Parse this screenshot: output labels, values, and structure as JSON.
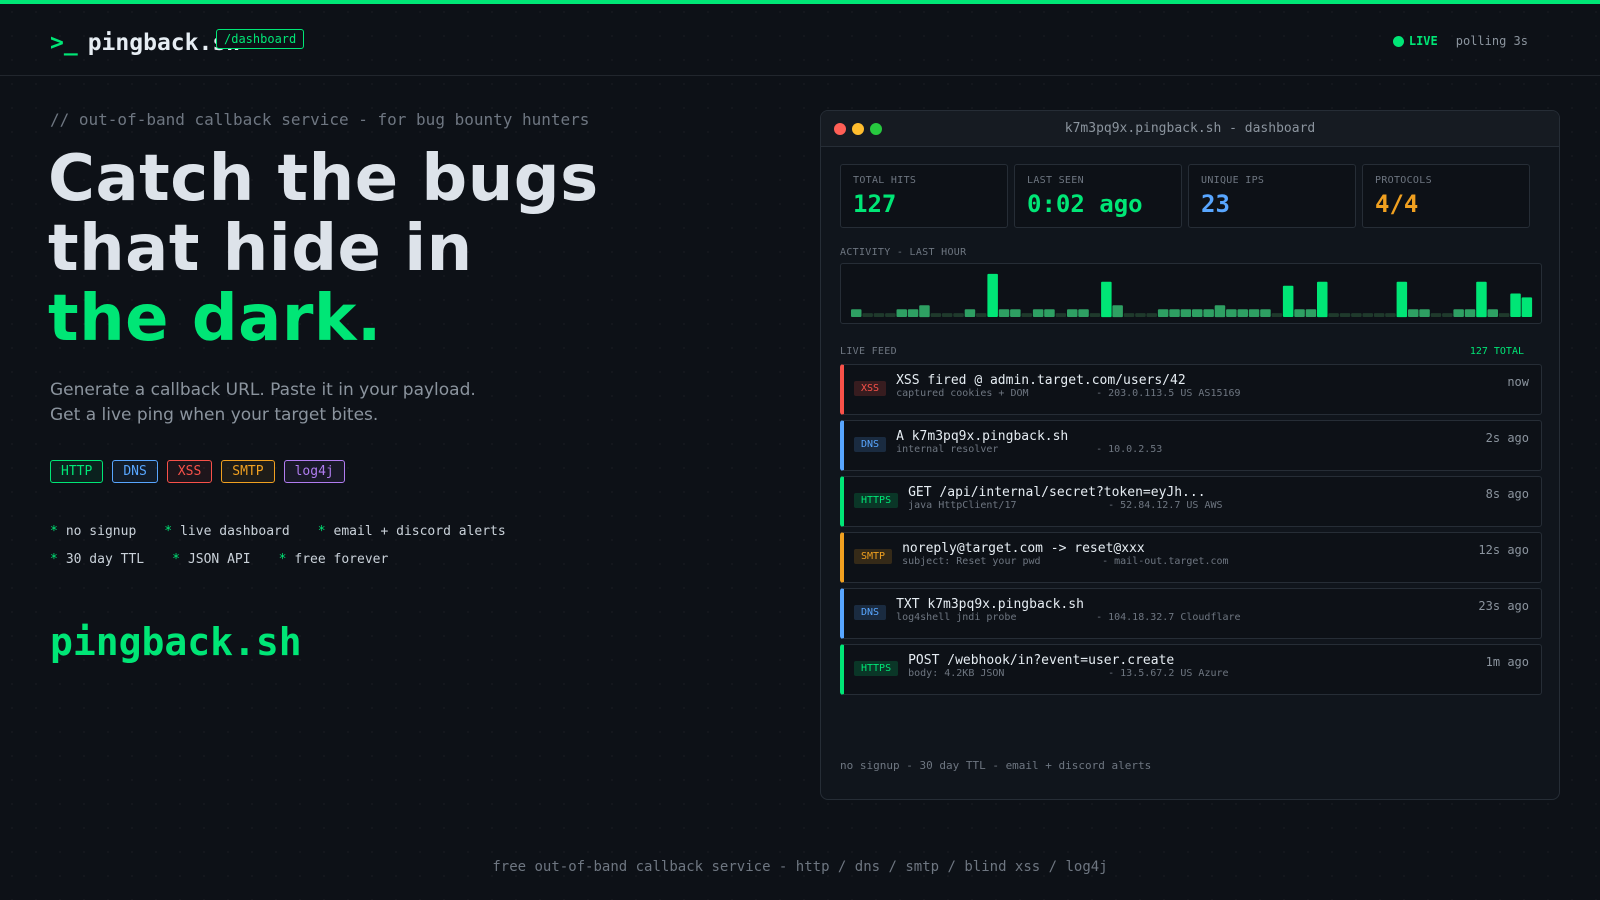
{
  "colors": {
    "accent": "#00e676",
    "dns": "#58a6ff",
    "xss": "#f85149",
    "smtp": "#f0a020",
    "log4j": "#b07cf0"
  },
  "header": {
    "prompt": ">_",
    "brand": "pingback.sh",
    "tag": "/dashboard",
    "live_label": "LIVE",
    "polling": "polling 3s"
  },
  "hero": {
    "tagline": "// out-of-band callback service - for bug bounty hunters",
    "line1": "Catch the bugs",
    "line2": "that hide in",
    "line3": "the dark.",
    "sub1": "Generate a callback URL. Paste it in your payload.",
    "sub2": "Get a live ping when your target bites."
  },
  "chips": [
    "HTTP",
    "DNS",
    "XSS",
    "SMTP",
    "log4j"
  ],
  "features": {
    "row1": [
      "no signup",
      "live dashboard",
      "email + discord alerts"
    ],
    "row2": [
      "30 day TTL",
      "JSON API",
      "free forever"
    ]
  },
  "big_brand": "pingback.sh",
  "footer": "free out-of-band callback service - http / dns / smtp / blind xss / log4j",
  "window": {
    "title": "k7m3pq9x.pingback.sh - dashboard",
    "stats": [
      {
        "label": "TOTAL HITS",
        "value": "127",
        "color": "#00e676"
      },
      {
        "label": "LAST SEEN",
        "value": "0:02 ago",
        "color": "#00e676"
      },
      {
        "label": "UNIQUE IPS",
        "value": "23",
        "color": "#58a6ff"
      },
      {
        "label": "PROTOCOLS",
        "value": "4/4",
        "color": "#f0a020"
      }
    ],
    "activity_label": "ACTIVITY - LAST HOUR",
    "feed_label": "LIVE FEED",
    "feed_total": "127 TOTAL",
    "feed": [
      {
        "type": "XSS",
        "title": "XSS fired @ admin.target.com/users/42",
        "meta1": "captured cookies + DOM",
        "meta2": "- 203.0.113.5 US AS15169",
        "time": "now"
      },
      {
        "type": "DNS",
        "title": "A k7m3pq9x.pingback.sh",
        "meta1": "internal resolver",
        "meta2": "- 10.0.2.53",
        "time": "2s ago"
      },
      {
        "type": "HTTPS",
        "title": "GET /api/internal/secret?token=eyJh...",
        "meta1": "java HttpClient/17",
        "meta2": "- 52.84.12.7 US AWS",
        "time": "8s ago"
      },
      {
        "type": "SMTP",
        "title": "noreply@target.com -> reset@xxx",
        "meta1": "subject: Reset your pwd",
        "meta2": "- mail-out.target.com",
        "time": "12s ago"
      },
      {
        "type": "DNS",
        "title": "TXT k7m3pq9x.pingback.sh",
        "meta1": "log4shell jndi probe",
        "meta2": "- 104.18.32.7 Cloudflare",
        "time": "23s ago"
      },
      {
        "type": "HTTPS",
        "title": "POST /webhook/in?event=user.create",
        "meta1": "body: 4.2KB JSON",
        "meta2": "- 13.5.67.2 US Azure",
        "time": "1m ago"
      }
    ],
    "footer": "no signup - 30 day TTL - email + discord alerts"
  },
  "chart_data": {
    "type": "bar",
    "title": "ACTIVITY - LAST HOUR",
    "values": [
      2,
      1,
      1,
      1,
      2,
      2,
      3,
      1,
      1,
      1,
      2,
      1,
      11,
      2,
      2,
      1,
      2,
      2,
      1,
      2,
      2,
      1,
      9,
      3,
      1,
      1,
      1,
      2,
      2,
      2,
      2,
      2,
      3,
      2,
      2,
      2,
      2,
      1,
      8,
      2,
      2,
      9,
      1,
      1,
      1,
      1,
      1,
      1,
      9,
      2,
      2,
      1,
      1,
      2,
      2,
      9,
      2,
      1,
      6,
      5
    ],
    "bright_threshold": 5,
    "ylim": [
      0,
      12
    ]
  }
}
